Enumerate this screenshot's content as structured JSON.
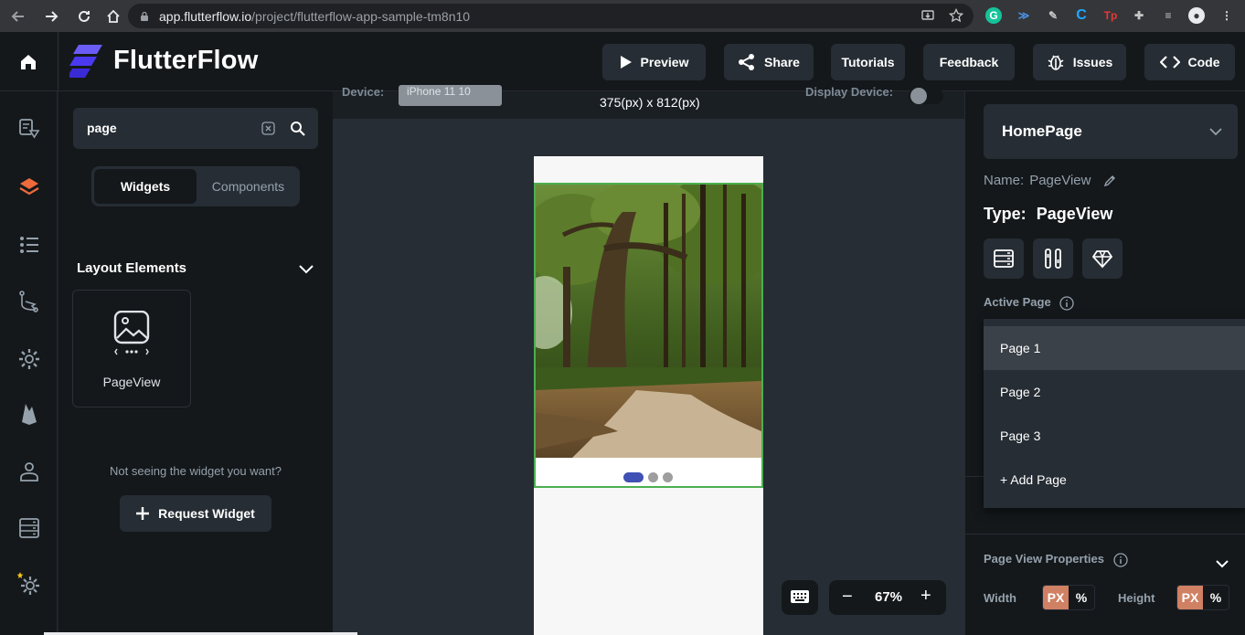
{
  "browser": {
    "url_host": "app.flutterflow.io",
    "url_path": "/project/flutterflow-app-sample-tm8n10"
  },
  "app": {
    "brand": "FlutterFlow",
    "toolbar": {
      "preview": "Preview",
      "share": "Share",
      "tutorials": "Tutorials",
      "feedback": "Feedback",
      "issues": "Issues",
      "code": "Code"
    }
  },
  "widget_panel": {
    "search_value": "page",
    "tabs": {
      "widgets": "Widgets",
      "components": "Components"
    },
    "section_title": "Layout Elements",
    "widget_card_label": "PageView",
    "hint": "Not seeing the widget you want?",
    "request_button": "Request Widget"
  },
  "canvas": {
    "device_label": "Device:",
    "device_value": "iPhone 11 10",
    "size_text": "375(px) x 812(px)",
    "display_device_label": "Display Device:",
    "page_indicator": {
      "count": 3,
      "active_index": 0
    },
    "zoom_minus": "−",
    "zoom_value": "67%",
    "zoom_plus": "+"
  },
  "properties": {
    "page_selector": "HomePage",
    "name_label": "Name:",
    "name_value": "PageView",
    "type_label": "Type:",
    "type_value": "PageView",
    "active_page_label": "Active Page",
    "dropdown_items": [
      "Page 1",
      "Page 2",
      "Page 3",
      "+ Add Page"
    ],
    "selected_item": "Page 1",
    "page_view_properties_label": "Page View Properties",
    "width_label": "Width",
    "height_label": "Height",
    "unit_px": "PX",
    "unit_pct": "%"
  },
  "colors": {
    "accent_orange": "#d08063",
    "indicator_active": "#3f51b5",
    "pageview_border": "#4caf50",
    "layers_icon": "#ee6a3b"
  }
}
